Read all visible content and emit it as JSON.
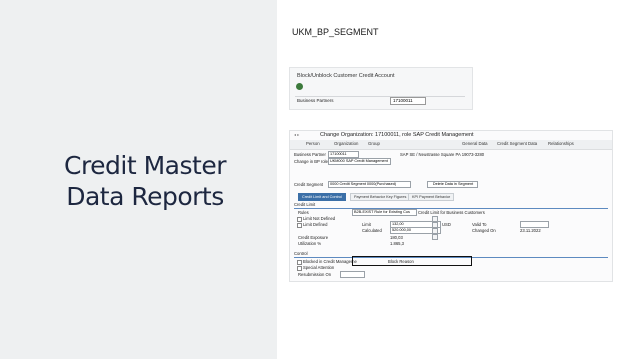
{
  "slide": {
    "title_line1": "Credit Master",
    "title_line2": "Data Reports",
    "transaction_code": "UKM_BP_SEGMENT"
  },
  "report_screen": {
    "header": "Block/Unblock Customer Credit Account",
    "field_label": "Business Partners",
    "field_value": "17100011"
  },
  "bp_screen": {
    "window_title": "Change Organization: 17100011, role SAP Credit Management",
    "toolbar": [
      "Person",
      "Organization",
      "Group",
      "General Data",
      "Credit Segment Data",
      "Relationships"
    ],
    "business_partner_label": "Business Partner",
    "business_partner_value": "17100011",
    "business_partner_desc": "SAP SE / Neustrasse Square PA 19073-3280",
    "role_label": "Change in BP role",
    "role_value": "UKM000 SAP Credit Management",
    "credit_segment_label": "Credit Segment",
    "credit_segment_value": "0000 Credit Segment 0000(Purchased)",
    "delete_button": "Delete Data in Segment",
    "tabs": [
      "Credit Limit and Control",
      "Payment Behavior Key Figures",
      "KPI Payment Behavior"
    ],
    "credit_limit_section": "Credit Limit",
    "rules_label": "Rules",
    "rules_value": "B2B-EXIST Rule for Existing Cus",
    "rules_desc": "Credit Limit for Business Customers",
    "limit_not_defined": "Limit Not Defined",
    "limit_defined": "Limit Defined",
    "limit_label": "Limit",
    "limit_value": "132,00",
    "currency": "USD",
    "valid_to": "Valid To",
    "calculated_label": "Calculated",
    "calculated_value": "520.000,00",
    "changed_on_label": "Changed On",
    "changed_on_value": "23.11.2022",
    "exposure_label": "Credit Exposure",
    "exposure_value": "180,03",
    "utilization_label": "Utilization %",
    "utilization_value": "1.865,3",
    "control_section": "Control",
    "blocked_label": "Blocked in Credit Manageme",
    "block_reason_label": "Block Reason",
    "special_attention": "Special Attention",
    "resubmission_label": "Resubmission On"
  },
  "colors": {
    "slide_title": "#1d2740",
    "left_panel": "#eef0f1",
    "sap_tab_active": "#3b6fa7"
  }
}
